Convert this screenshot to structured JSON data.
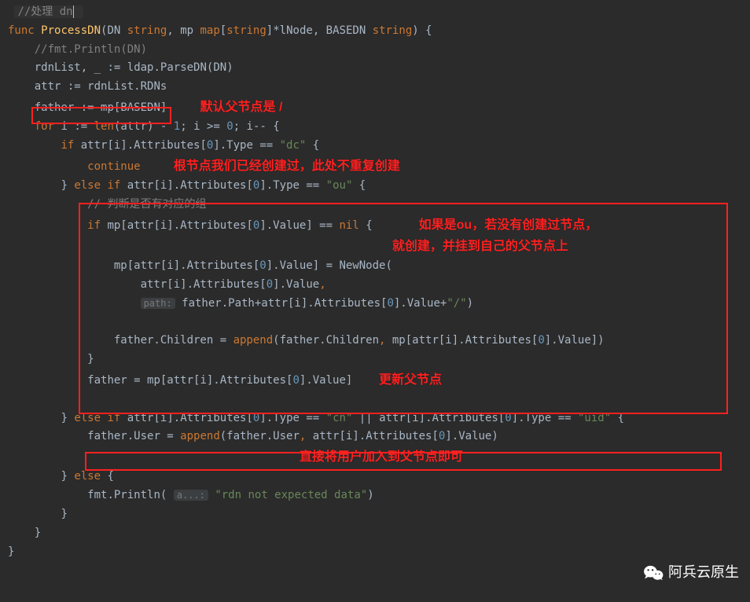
{
  "comment_top": "//处理 dn",
  "func_sig": {
    "keyword_func": "func",
    "name": "ProcessDN",
    "p1": "DN",
    "p1t": "string",
    "p2": "mp",
    "p2t_map": "map",
    "p2t_key": "string",
    "p2t_val": "*lNode",
    "p3": "BASEDN",
    "p3t": "string",
    "open": " {"
  },
  "l_fmt_comment": "//fmt.Println(DN)",
  "l_rdnlist": {
    "a": "rdnList",
    "blank": "_",
    "assign": ":=",
    "pkg": "ldap",
    "fn": ".ParseDN",
    "arg": "(DN)"
  },
  "l_attr": {
    "a": "attr",
    "assign": ":=",
    "rhs": "rdnList.RDNs"
  },
  "l_father_assign": {
    "a": "father",
    "assign": ":=",
    "rhs1": "mp[",
    "rhs2": "BASEDN",
    "rhs3": "]"
  },
  "annot1": "默认父节点是 /",
  "l_for": {
    "kfor": "for",
    "var": "i",
    "assign": ":=",
    "len": "len",
    "arg": "(attr)",
    "minus": " - ",
    "one": "1",
    "semi": "; i >= ",
    "zero": "0",
    "semi2": "; i-- {"
  },
  "l_if_dc": {
    "kif": "if",
    "lhs": "attr[i].Attributes[",
    "zero": "0",
    "mid": "].Type == ",
    "str": "\"dc\"",
    "open": " {"
  },
  "l_continue": "continue",
  "annot2": "根节点我们已经创建过，此处不重复创建",
  "l_else_ou": {
    "close": "}",
    "kelse": "else if",
    "lhs": "attr[i].Attributes[",
    "zero": "0",
    "mid": "].Type == ",
    "str": "\"ou\"",
    "open": " {"
  },
  "l_comment_group": "// 判断是否有对应的组",
  "l_if_nil": {
    "kif": "if",
    "lhs1": "mp[attr[i].Attributes[",
    "zero": "0",
    "mid": "].Value] == ",
    "knil": "nil",
    "open": " {"
  },
  "annot3a": "如果是ou，若没有创建过节点，",
  "annot3b": "就创建，并挂到自己的父节点上",
  "l_newnode": {
    "lhs1": "mp[attr[i].Attributes[",
    "zero": "0",
    "mid": "].Value] = NewNode("
  },
  "l_arg1": {
    "txt": "attr[i].Attributes[",
    "zero": "0",
    "end": "].Value",
    "comma": ","
  },
  "l_arg2": {
    "hint": "path:",
    "txt1": "father.Path+attr[i].Attributes[",
    "zero": "0",
    "txt2": "].Value+",
    "str": "\"/\"",
    "close": ")"
  },
  "l_children": {
    "lhs": "father.Children = ",
    "fn": "append",
    "args1": "(father.Children",
    "comma": ", ",
    "args2": "mp[attr[i].Attributes[",
    "zero": "0",
    "args3": "].Value])"
  },
  "l_close_inner": "}",
  "l_father_update": {
    "lhs": "father = mp[attr[i].Attributes[",
    "zero": "0",
    "rhs": "].Value]"
  },
  "annot4": "更新父节点",
  "l_else_cn": {
    "close": "}",
    "kelse": "else if",
    "lhs1": "attr[i].Attributes[",
    "zero1": "0",
    "mid1": "].Type == ",
    "str1": "\"cn\"",
    "or": " || ",
    "lhs2": "attr[i].Attributes[",
    "zero2": "0",
    "mid2": "].Type == ",
    "str2": "\"uid\"",
    "open": " {"
  },
  "l_user_append": {
    "lhs": "father.User = ",
    "fn": "append",
    "args1": "(father.User",
    "comma": ", ",
    "args2": "attr[i].Attributes[",
    "zero": "0",
    "args3": "].Value)"
  },
  "annot5": "直接将用户加入到父节点即可",
  "l_else": {
    "close": "}",
    "kelse": "else",
    "open": " {"
  },
  "l_println": {
    "pkg": "fmt",
    "fn": ".Println(",
    "hint": "a...:",
    "str": "\"rdn not expected data\"",
    "close": ")"
  },
  "closes": {
    "c1": "}",
    "c2": "}",
    "c3": "}"
  },
  "watermark": "阿兵云原生"
}
